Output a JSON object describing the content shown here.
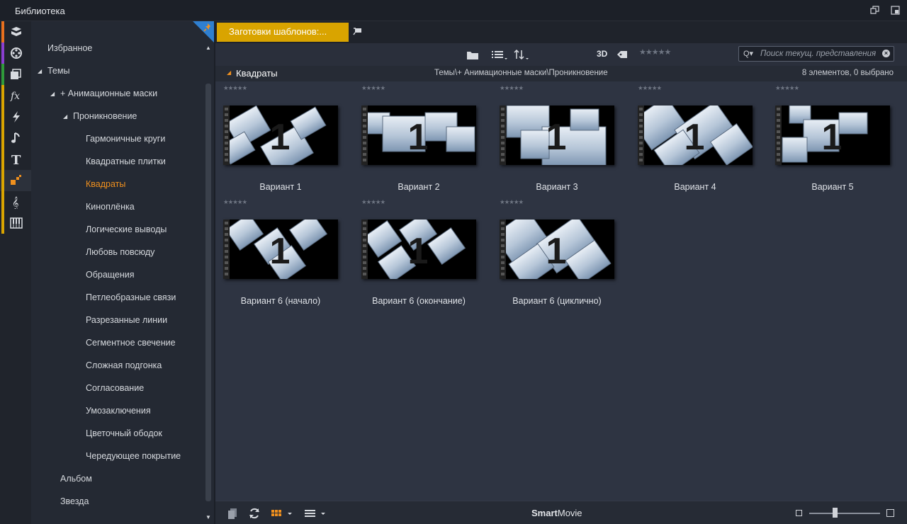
{
  "window": {
    "title": "Библиотека"
  },
  "iconstrip": {
    "items": [
      {
        "name": "project-bin-icon",
        "color": "#e8701e"
      },
      {
        "name": "film-reel-icon",
        "color": "#8a3fd0"
      },
      {
        "name": "photos-icon",
        "color": "#2f9a3a"
      },
      {
        "name": "fx-icon",
        "color": "#d9a400"
      },
      {
        "name": "transitions-icon",
        "color": "#d9a400"
      },
      {
        "name": "music-icon",
        "color": "#d9a400"
      },
      {
        "name": "titles-icon",
        "color": "#d9a400"
      },
      {
        "name": "montage-icon",
        "color": "#d9a400"
      },
      {
        "name": "scorefitter-icon",
        "color": "#d9a400"
      },
      {
        "name": "piano-icon",
        "color": "#d9a400"
      }
    ]
  },
  "tree": {
    "nodes": [
      {
        "label": "Избранное"
      },
      {
        "label": "Темы"
      },
      {
        "label": "+ Анимационные маски"
      },
      {
        "label": "Проникновение"
      },
      {
        "label": "Гармоничные круги"
      },
      {
        "label": "Квадратные плитки"
      },
      {
        "label": "Квадраты"
      },
      {
        "label": "Киноплёнка"
      },
      {
        "label": "Логические выводы"
      },
      {
        "label": "Любовь повсюду"
      },
      {
        "label": "Обращения"
      },
      {
        "label": "Петлеобразные связи"
      },
      {
        "label": "Разрезанные линии"
      },
      {
        "label": "Сегментное свечение"
      },
      {
        "label": "Сложная подгонка"
      },
      {
        "label": "Согласование"
      },
      {
        "label": "Умозаключения"
      },
      {
        "label": "Цветочный ободок"
      },
      {
        "label": "Чередующее покрытие"
      },
      {
        "label": "Альбом"
      },
      {
        "label": "Звезда"
      }
    ],
    "active_color": "#f0901e"
  },
  "tabs": [
    {
      "label": "Заготовки шаблонов:..."
    }
  ],
  "toolbar": {
    "mode_3d": "3D",
    "stars": "★★★★★",
    "search_placeholder": "Поиск текущ. представления",
    "search_icon": "Q▾",
    "clear": "×"
  },
  "header": {
    "category": "Квадраты",
    "path": "Темы\\+ Анимационные маски\\Проникновение",
    "count": "8 элементов, 0 выбрано"
  },
  "items": [
    {
      "label": "Вариант 1",
      "stars": "★★★★★"
    },
    {
      "label": "Вариант 2",
      "stars": "★★★★★"
    },
    {
      "label": "Вариант 3",
      "stars": "★★★★★"
    },
    {
      "label": "Вариант 4",
      "stars": "★★★★★"
    },
    {
      "label": "Вариант 5",
      "stars": "★★★★★"
    },
    {
      "label": "Вариант 6 (начало)",
      "stars": "★★★★★"
    },
    {
      "label": "Вариант 6 (окончание)",
      "stars": "★★★★★"
    },
    {
      "label": "Вариант 6 (циклично)",
      "stars": "★★★★★"
    }
  ],
  "bottombar": {
    "smartmovie_bold": "Smart",
    "smartmovie_rest": "Movie",
    "zoom_level": 0.36
  },
  "colors": {
    "accent": "#d9a400",
    "orange": "#f0901e",
    "panel": "#2e3442"
  }
}
